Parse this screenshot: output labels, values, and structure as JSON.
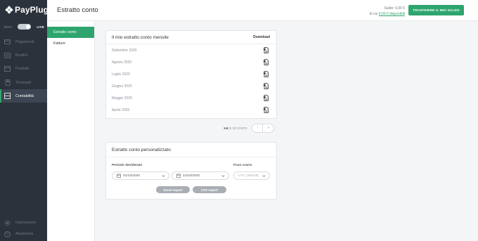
{
  "brand": {
    "name": "PayPlug"
  },
  "mode": {
    "test_label": "TEST",
    "live_label": "LIVE"
  },
  "sidebar": {
    "items": [
      {
        "label": "Pagamenti",
        "icon": "card-icon"
      },
      {
        "label": "Bonifici",
        "icon": "transfer-icon"
      },
      {
        "label": "Prodotti",
        "icon": "box-icon"
      },
      {
        "label": "Terminali",
        "icon": "terminal-icon"
      },
      {
        "label": "Contabilità",
        "icon": "ledger-icon"
      }
    ],
    "bottom_items": [
      {
        "label": "Impostazioni",
        "icon": "gear-icon"
      },
      {
        "label": "Assistenza",
        "icon": "help-icon"
      }
    ]
  },
  "header": {
    "title": "Estratto conto",
    "saldo_label": "Saldo:",
    "saldo_value": "0,00 €",
    "available_prefix": "di cui",
    "available_value": "0,00 € disponibili",
    "transfer_button": "TRASFERIRE IL MIO SALDO"
  },
  "subnav": {
    "items": [
      "Estratto conto",
      "Fatture"
    ]
  },
  "monthly": {
    "title": "Il mio estratto conto mensile",
    "download_label": "Download",
    "rows": [
      "Settembre 2020",
      "Agosto 2020",
      "Luglio 2020",
      "Giugno 2020",
      "Maggio 2020",
      "Aprile 2020"
    ]
  },
  "pagination": {
    "range": "1-6",
    "suffix": "DI 33 CONTO",
    "prev": "‹",
    "next": "›"
  },
  "custom": {
    "title": "Estratto conto personalizzato",
    "period_label": "Periodo desiderato",
    "timezone_label": "Fuso orario",
    "date_from": "01/10/2020",
    "date_to": "12/10/2020",
    "timezone_value": "UTC (default)",
    "excel_button": "Excel export",
    "csv_button": "CSV export"
  },
  "colors": {
    "accent": "#2ea56e",
    "sidebar_bg": "#2b323c",
    "export_button_bg": "#a9aeb4"
  }
}
